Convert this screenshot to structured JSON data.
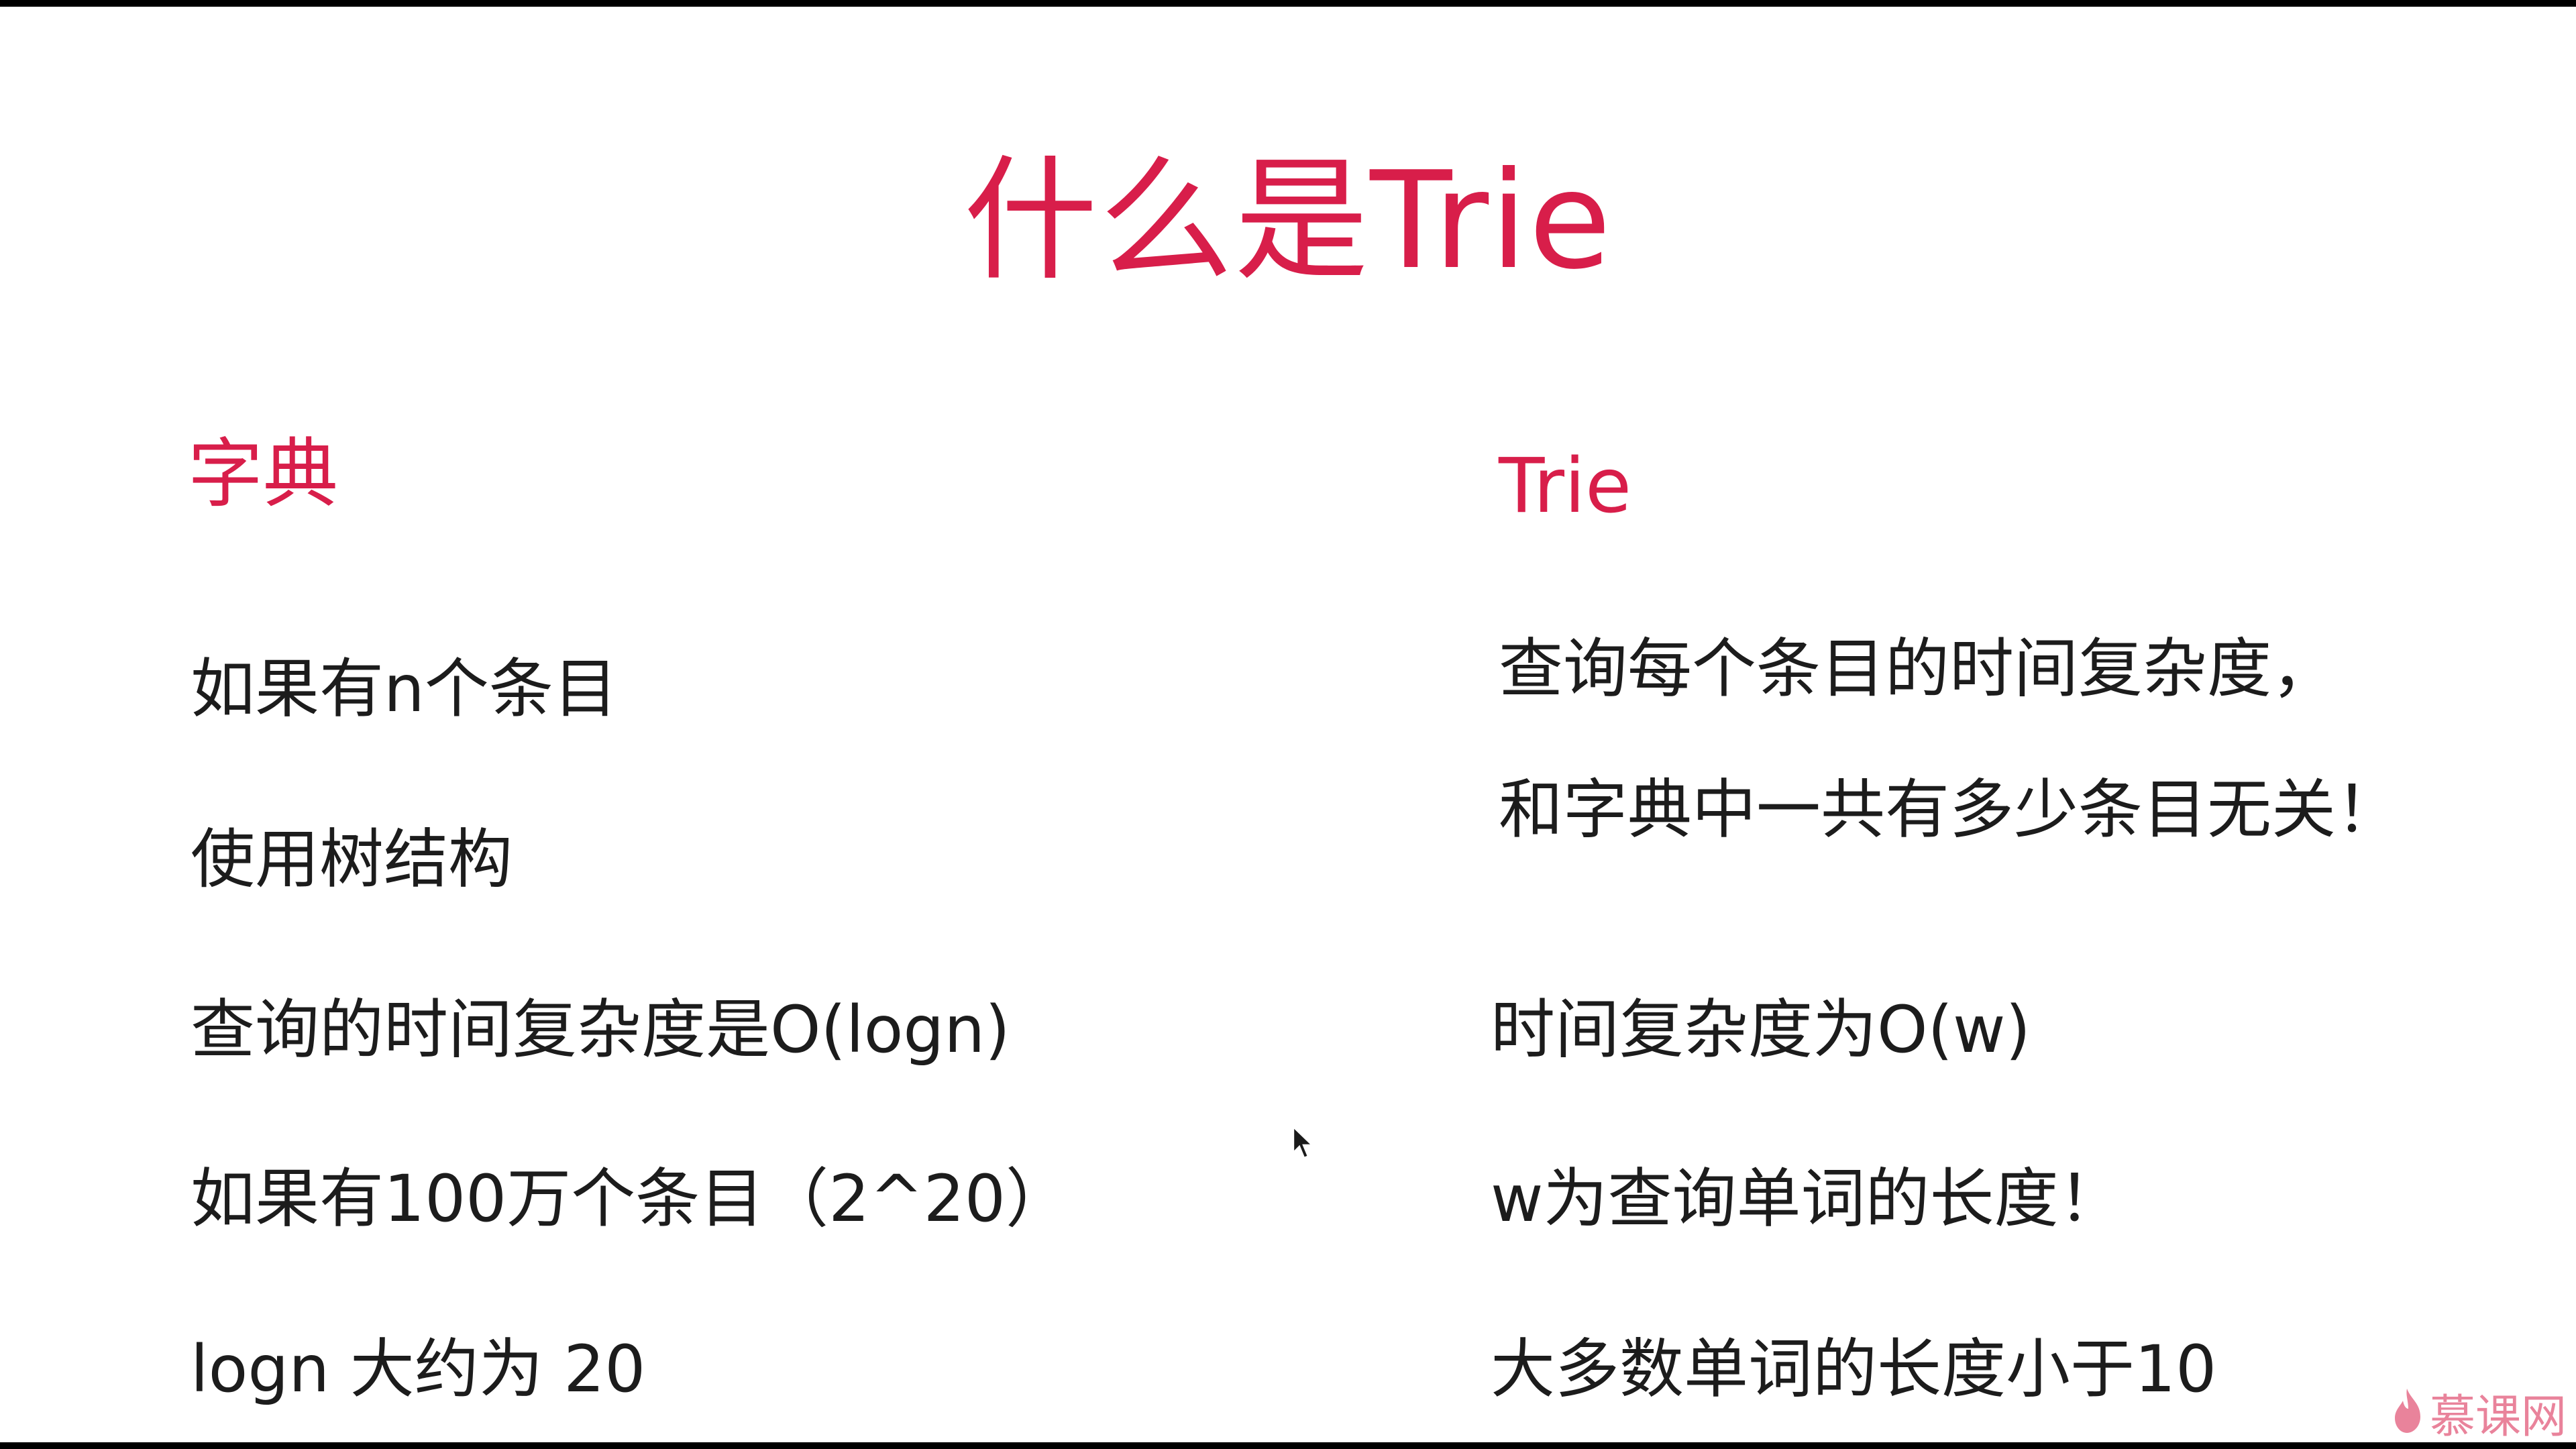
{
  "title": "什么是Trie",
  "left": {
    "heading": "字典",
    "lines": [
      "如果有n个条目",
      "使用树结构",
      "查询的时间复杂度是O(logn)",
      "如果有100万个条目（2^20）",
      "logn 大约为 20"
    ]
  },
  "right": {
    "heading": "Trie",
    "lines": [
      "查询每个条目的时间复杂度，",
      "和字典中一共有多少条目无关！",
      "时间复杂度为O(w)",
      "w为查询单词的长度！",
      "大多数单词的长度小于10"
    ]
  },
  "watermark": {
    "text": "慕课网",
    "icon": "flame-logo-icon"
  },
  "cursor": {
    "icon": "mouse-pointer-icon"
  },
  "colors": {
    "accent": "#d81e4a",
    "text": "#1c1c1c",
    "background": "#ffffff",
    "letterbox": "#000000"
  }
}
